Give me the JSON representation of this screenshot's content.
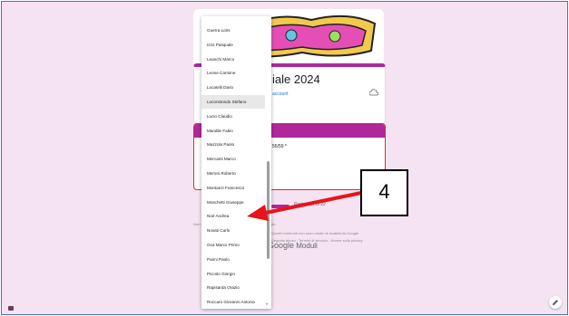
{
  "form": {
    "title": "iale 2024",
    "account_text": "account",
    "question_text": "55/59 *",
    "page_label": "Pagina 14 di 22",
    "footer_left": "Non inviare mai le password tramite Moduli Google.",
    "footer_right": "Questi contenuti non sono creati né avallati da Google.",
    "footer_links": "Segnala abuso - Termini di servizio - Norme sulla privacy",
    "brand": "Google Moduli",
    "brand_g": "Google",
    "brand_m": "Moduli"
  },
  "dropdown": {
    "options": [
      "Guerra Loris",
      "Izzo Pasquale",
      "Leanchi Marco",
      "Leone Carmine",
      "Locatelli Dario",
      "Loconstondo Stefano",
      "Lucio Claudio",
      "Mandile Fabio",
      "Mazzola Paolo",
      "Mercanti Marco",
      "Meroni Roberto",
      "Montanzi Francesco",
      "Moschetti Giuseppe",
      "Noè Andrea",
      "Novati Carlo",
      "Oca Marco Primo",
      "Parini Paolo",
      "Piccolo Giorgio",
      "Rapisarda Orazio",
      "Roccaro Giovanni Antonio"
    ],
    "highlighted_index": 5
  },
  "annotation": {
    "label": "4",
    "arrow_color": "#e8141b"
  },
  "colors": {
    "accent": "#b0279b",
    "background": "#f6e3f1",
    "error": "#d93025"
  },
  "icons": {
    "cloud": "cloud-off-icon",
    "edit": "pencil-icon",
    "help": "feedback-icon"
  }
}
